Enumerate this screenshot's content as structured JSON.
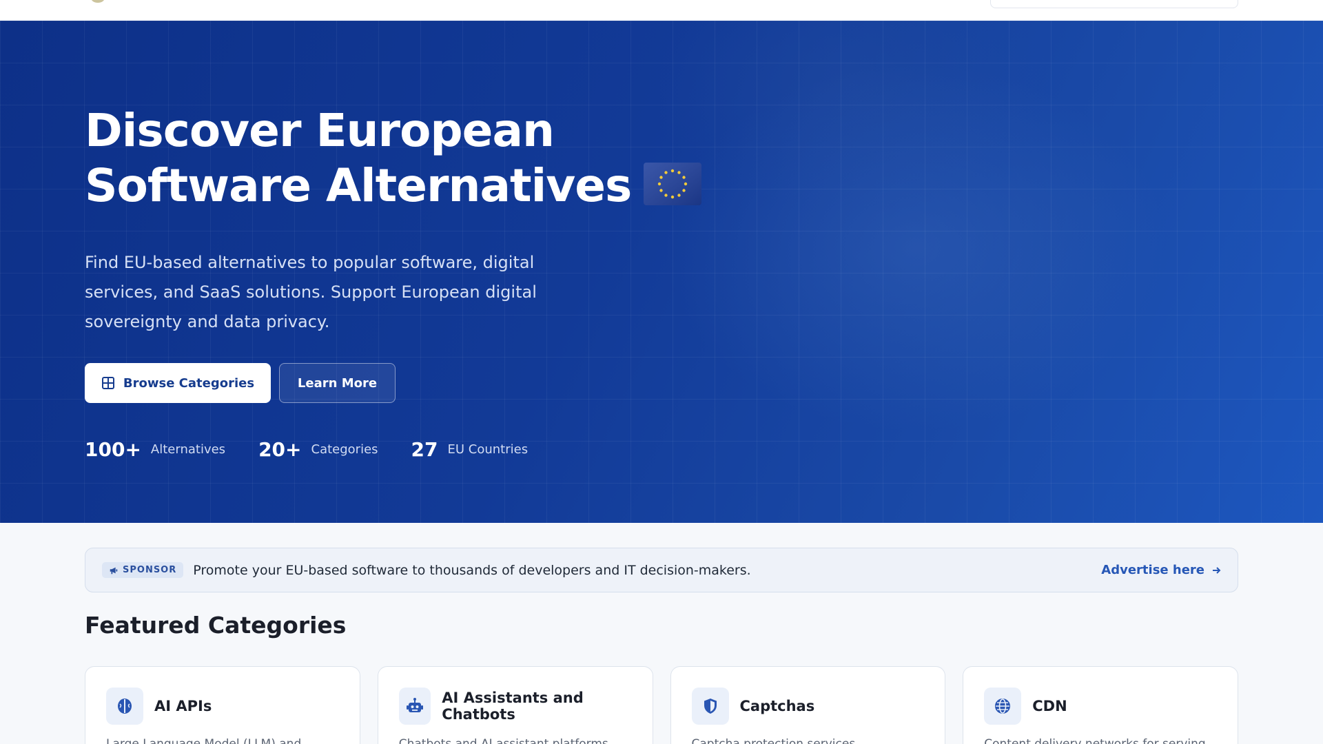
{
  "hero": {
    "title_line1": "Discover European",
    "title_line2": "Software Alternatives",
    "flag_icon": "eu-flag-icon",
    "subtitle": "Find EU-based alternatives to popular software, digital services, and SaaS solutions. Support European digital sovereignty and data privacy.",
    "primary_button": "Browse Categories",
    "secondary_button": "Learn More",
    "stats": [
      {
        "value": "100+",
        "label": "Alternatives"
      },
      {
        "value": "20+",
        "label": "Categories"
      },
      {
        "value": "27",
        "label": "EU Countries"
      }
    ]
  },
  "sponsor": {
    "badge": "SPONSOR",
    "text": "Promote your EU-based software to thousands of developers and IT decision-makers.",
    "link": "Advertise here"
  },
  "featured": {
    "title": "Featured Categories",
    "cards": [
      {
        "title": "AI APIs",
        "description": "Large Language Model (LLM) and",
        "icon": "brain-icon"
      },
      {
        "title": "AI Assistants and Chatbots",
        "description": "Chatbots and AI assistant platforms",
        "icon": "robot-icon"
      },
      {
        "title": "Captchas",
        "description": "Captcha protection services",
        "icon": "shield-icon"
      },
      {
        "title": "CDN",
        "description": "Content delivery networks for serving",
        "icon": "globe-icon"
      }
    ]
  },
  "colors": {
    "hero_start": "#0d3088",
    "hero_end": "#1d57bf",
    "accent": "#2657b6"
  }
}
